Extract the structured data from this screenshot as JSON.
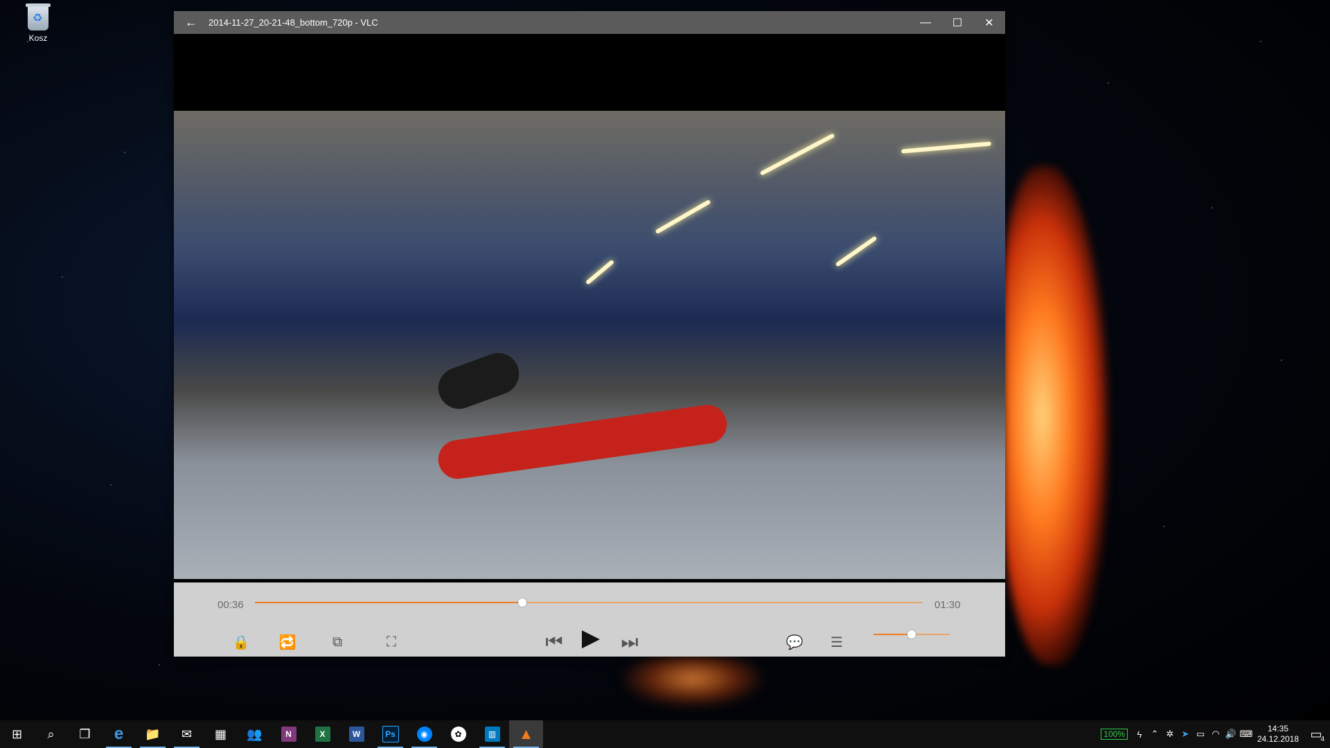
{
  "desktop": {
    "icons": [
      {
        "label": "Kosz",
        "icon": "recycle-bin-icon"
      }
    ]
  },
  "window": {
    "title": "2014-11-27_20-21-48_bottom_720p - VLC",
    "controls": {
      "back": "←",
      "minimize": "—",
      "maximize": "☐",
      "close": "✕"
    }
  },
  "player": {
    "elapsed": "00:36",
    "duration": "01:30",
    "progress": 0.4,
    "volume": 0.5,
    "accent_color": "#f07c1e",
    "buttons": {
      "lock": "🔒",
      "repeat": "🔁",
      "screenshot": "⧉",
      "fullscreen": "⛶",
      "previous": "⏮",
      "play": "▶",
      "next": "⏭",
      "subtitles": "💬",
      "equalizer": "☰"
    }
  },
  "taskbar": {
    "apps": [
      {
        "name": "start",
        "glyph": "⊞"
      },
      {
        "name": "search",
        "glyph": "⌕"
      },
      {
        "name": "task-view",
        "glyph": "❐"
      },
      {
        "name": "edge",
        "glyph": "e"
      },
      {
        "name": "file-explorer",
        "glyph": "📁"
      },
      {
        "name": "mail",
        "glyph": "✉"
      },
      {
        "name": "calendar",
        "glyph": "▦"
      },
      {
        "name": "people",
        "glyph": "👥"
      },
      {
        "name": "onenote",
        "glyph": "N"
      },
      {
        "name": "excel",
        "glyph": "X"
      },
      {
        "name": "word",
        "glyph": "W"
      },
      {
        "name": "photoshop",
        "glyph": "Ps"
      },
      {
        "name": "messenger",
        "glyph": "◉"
      },
      {
        "name": "app",
        "glyph": "✿"
      },
      {
        "name": "trello",
        "glyph": "▥"
      },
      {
        "name": "vlc",
        "glyph": "▲"
      }
    ],
    "battery": "100%",
    "time": "14:35",
    "date": "24.12.2018",
    "notifications": "4"
  }
}
